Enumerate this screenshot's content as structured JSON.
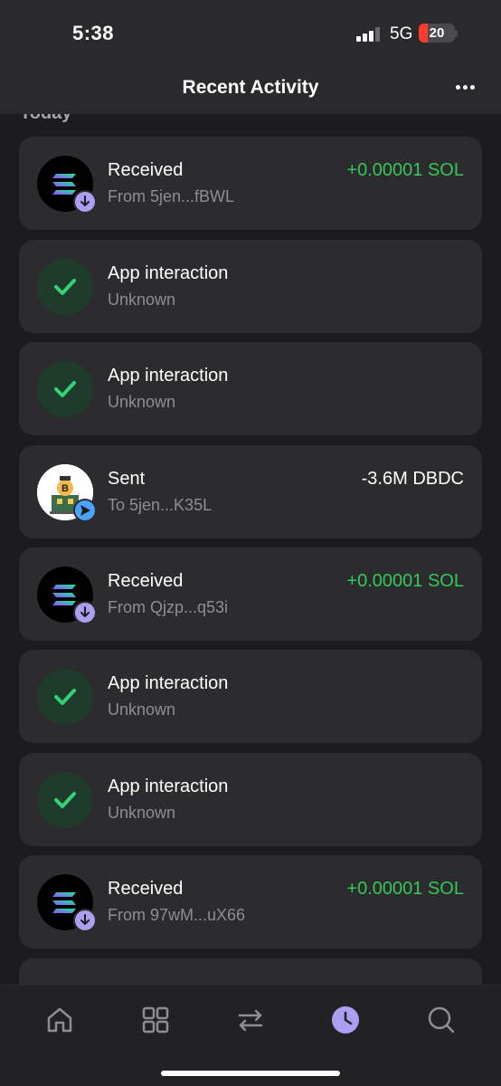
{
  "status_bar": {
    "time": "5:38",
    "network": "5G",
    "battery": "20"
  },
  "header": {
    "title": "Recent Activity",
    "more_icon": "ellipsis-icon"
  },
  "section": {
    "label": "Today"
  },
  "activity": [
    {
      "title": "Received",
      "subtitle": "From 5jen...fBWL",
      "amount": "+0.00001 SOL",
      "icon": "solana-icon",
      "badge": "arrow-down-icon"
    },
    {
      "title": "App interaction",
      "subtitle": "Unknown",
      "amount": "",
      "icon": "checkmark-icon"
    },
    {
      "title": "App interaction",
      "subtitle": "Unknown",
      "amount": "",
      "icon": "checkmark-icon"
    },
    {
      "title": "Sent",
      "subtitle": "To 5jen...K35L",
      "amount": "-3.6M DBDC",
      "icon": "token-avatar",
      "badge": "send-arrow-icon"
    },
    {
      "title": "Received",
      "subtitle": "From Qjzp...q53i",
      "amount": "+0.00001 SOL",
      "icon": "solana-icon",
      "badge": "arrow-down-icon"
    },
    {
      "title": "App interaction",
      "subtitle": "Unknown",
      "amount": "",
      "icon": "checkmark-icon"
    },
    {
      "title": "App interaction",
      "subtitle": "Unknown",
      "amount": "",
      "icon": "checkmark-icon"
    },
    {
      "title": "Received",
      "subtitle": "From 97wM...uX66",
      "amount": "+0.00001 SOL",
      "icon": "solana-icon",
      "badge": "arrow-down-icon"
    }
  ],
  "nav": [
    {
      "icon": "home-icon",
      "active": false
    },
    {
      "icon": "apps-grid-icon",
      "active": false
    },
    {
      "icon": "swap-icon",
      "active": false
    },
    {
      "icon": "clock-icon",
      "active": true
    },
    {
      "icon": "search-icon",
      "active": false
    }
  ],
  "colors": {
    "accent": "#ab9ff2",
    "positive": "#34c759",
    "card": "#2c2c2e",
    "background": "#1c1c1e"
  }
}
